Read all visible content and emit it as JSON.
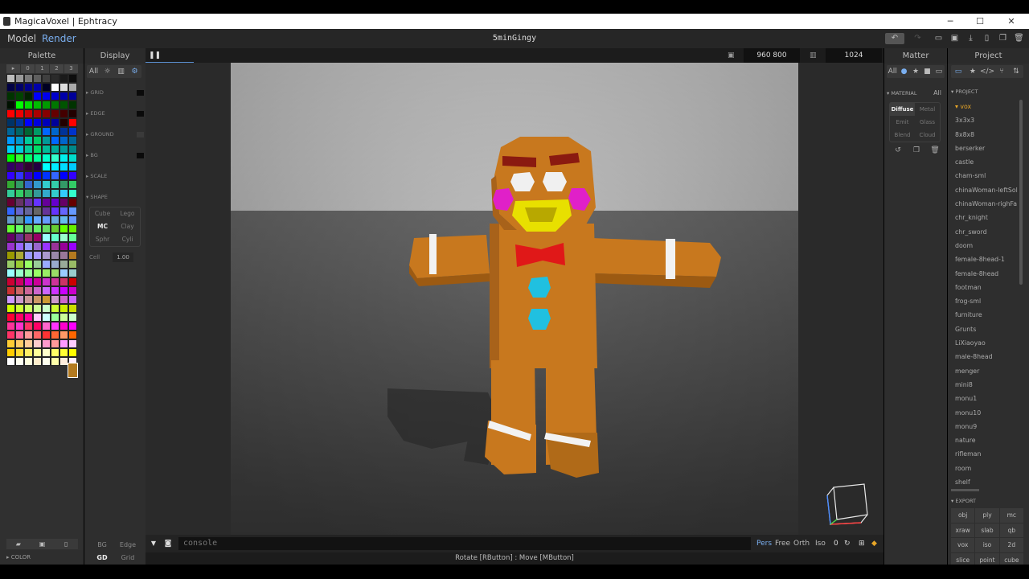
{
  "window": {
    "title": "MagicaVoxel | Ephtracy",
    "controls": [
      "─",
      "☐",
      "✕"
    ]
  },
  "menu": {
    "model": "Model",
    "render": "Render",
    "project_name": "5minGingy"
  },
  "toolbar_icons": [
    "undo-icon",
    "redo-icon",
    "open-icon",
    "save-icon",
    "export-icon",
    "new-icon",
    "copy-icon",
    "delete-icon"
  ],
  "palette": {
    "title": "Palette",
    "tabs": [
      "▸",
      "0",
      "1",
      "2",
      "3"
    ],
    "colors": [
      "#bdbdbd",
      "#9a9a9a",
      "#7a7a7a",
      "#5e5e5e",
      "#3f3f3f",
      "#2a2a2a",
      "#1a1a1a",
      "#0d0d0d",
      "#000044",
      "#000066",
      "#000088",
      "#0000aa",
      "#000022",
      "#ffffff",
      "#dddddd",
      "#aaaaaa",
      "#003300",
      "#004400",
      "#002200",
      "#0000ff",
      "#0000ee",
      "#0000cc",
      "#0000aa",
      "#000099",
      "#001100",
      "#00ff00",
      "#00dd00",
      "#00bb00",
      "#009900",
      "#007700",
      "#005500",
      "#003300",
      "#ff0000",
      "#ee0000",
      "#cc0000",
      "#aa0000",
      "#880000",
      "#660000",
      "#440000",
      "#220000",
      "#003366",
      "#003399",
      "#0000ff",
      "#0000dd",
      "#0000bb",
      "#000099",
      "#220000",
      "#ff0000",
      "#006699",
      "#006666",
      "#006633",
      "#009966",
      "#0066ff",
      "#0066cc",
      "#003399",
      "#0033cc",
      "#0099ff",
      "#0099cc",
      "#00cc99",
      "#00cc66",
      "#009999",
      "#0066ff",
      "#0066cc",
      "#006699",
      "#00ccff",
      "#00ccdd",
      "#00cc99",
      "#00dd66",
      "#00bb99",
      "#00aa99",
      "#009999",
      "#008888",
      "#00ff00",
      "#33ff33",
      "#00ff66",
      "#00ff99",
      "#00ffcc",
      "#33ffcc",
      "#00eeee",
      "#00ddcc",
      "#330066",
      "#440066",
      "#330033",
      "#220044",
      "#00ffff",
      "#00eeff",
      "#00ddff",
      "#00ccff",
      "#3300ff",
      "#3333ff",
      "#3300cc",
      "#0000ff",
      "#0033ff",
      "#3366ff",
      "#0000ff",
      "#3300ff",
      "#33aa33",
      "#339966",
      "#3366cc",
      "#3399cc",
      "#33cccc",
      "#33ccaa",
      "#339966",
      "#33cc66",
      "#33cc99",
      "#33cc66",
      "#33aa66",
      "#339999",
      "#33aacc",
      "#33cccc",
      "#33ccff",
      "#33ffcc",
      "#660033",
      "#663366",
      "#6633aa",
      "#6633ff",
      "#660099",
      "#6600cc",
      "#660066",
      "#660000",
      "#3366ff",
      "#6666cc",
      "#666699",
      "#666666",
      "#663399",
      "#6633ff",
      "#6666ff",
      "#6699ff",
      "#6699cc",
      "#669999",
      "#3399ff",
      "#66aaff",
      "#6699ff",
      "#66aadd",
      "#66bbee",
      "#6699ff",
      "#66ff33",
      "#66ff66",
      "#66cc66",
      "#66ee66",
      "#66dd66",
      "#66cc33",
      "#66ff00",
      "#66ee00",
      "#660066",
      "#663399",
      "#993366",
      "#990066",
      "#99ffff",
      "#66ffcc",
      "#99ffcc",
      "#66ff99",
      "#9933cc",
      "#9966ff",
      "#9999ff",
      "#9966cc",
      "#9933ff",
      "#993399",
      "#990099",
      "#9900ff",
      "#999900",
      "#aaaa33",
      "#9999ff",
      "#aa99ff",
      "#aa99cc",
      "#9988aa",
      "#997799",
      "#b37a20",
      "#99cc66",
      "#99cc33",
      "#99ff66",
      "#99cc99",
      "#99aaff",
      "#99aacc",
      "#99aa99",
      "#99bb66",
      "#99ffff",
      "#99ffcc",
      "#99ff99",
      "#99ff66",
      "#99ee66",
      "#99dd66",
      "#99ccff",
      "#99cccc",
      "#cc0033",
      "#cc0066",
      "#cc00cc",
      "#cc0099",
      "#cc33cc",
      "#cc3399",
      "#cc3366",
      "#cc0000",
      "#cc3333",
      "#cc6666",
      "#cc6699",
      "#cc66cc",
      "#cc66ff",
      "#cc33ff",
      "#cc00ff",
      "#cc00cc",
      "#cc99ff",
      "#cc99cc",
      "#cc9999",
      "#cc9966",
      "#cc9933",
      "#cc99cc",
      "#cc66cc",
      "#cc66ff",
      "#ccff00",
      "#ccff33",
      "#ccff66",
      "#ccff99",
      "#ccffcc",
      "#ccff33",
      "#ccee00",
      "#ccdd00",
      "#ff0033",
      "#ff0066",
      "#ff0099",
      "#ffccff",
      "#ccffff",
      "#99ff99",
      "#ccff99",
      "#ccffcc",
      "#ff3399",
      "#ff33cc",
      "#ff3366",
      "#ff0066",
      "#ff66cc",
      "#ff33ff",
      "#ff00cc",
      "#ff00ff",
      "#ff3366",
      "#ff6699",
      "#ff9999",
      "#ff6666",
      "#ff3333",
      "#ff6633",
      "#ff9966",
      "#ff6600",
      "#ffcc33",
      "#ffcc66",
      "#ffcc99",
      "#ffcccc",
      "#ff99cc",
      "#ff9999",
      "#ff99ff",
      "#ffccff",
      "#ffcc00",
      "#ffdd33",
      "#ffee66",
      "#ffff99",
      "#ffffcc",
      "#ffff66",
      "#ffff33",
      "#ffff00",
      "#ffffff",
      "#fffff0",
      "#ffffdd",
      "#ffeecc",
      "#ffffee",
      "#ffffaa",
      "#ffeedd",
      "#ffeeff"
    ],
    "bottom_icons": [
      "folder-icon",
      "save-icon",
      "file-icon"
    ],
    "color_label": "COLOR"
  },
  "display": {
    "title": "Display",
    "tabs": [
      "All",
      "☼",
      "▥",
      "⚙"
    ],
    "sections": [
      "GRID",
      "EDGE",
      "GROUND",
      "BG",
      "SCALE",
      "SHAPE"
    ],
    "shapes": [
      "Cube",
      "Lego",
      "MC",
      "Clay",
      "Sphr",
      "Cyli"
    ],
    "cell_label": "Cell",
    "cell_value": "1.00",
    "bottom": [
      "BG",
      "Edge",
      "GD",
      "Grid"
    ]
  },
  "render": {
    "resolution": "960  800",
    "samples": "1024",
    "console_placeholder": "console",
    "projections": [
      "Pers",
      "Free",
      "Orth",
      "Iso"
    ],
    "iso_value": "0",
    "status": "Rotate [RButton] : Move [MButton]"
  },
  "matter": {
    "title": "Matter",
    "tabs": [
      "All",
      "●",
      "★",
      "■",
      "▭"
    ],
    "material_label": "MATERIAL",
    "material_all": "All",
    "materials": [
      "Diffuse",
      "Metal",
      "Emit",
      "Glass",
      "Blend",
      "Cloud"
    ]
  },
  "project": {
    "title": "Project",
    "section": "PROJECT",
    "items": [
      "▾ vox",
      "3x3x3",
      "8x8x8",
      "berserker",
      "castle",
      "cham-sml",
      "chinaWoman-leftSol",
      "chinaWoman-righFa",
      "chr_knight",
      "chr_sword",
      "doom",
      "female-8head-1",
      "female-8head",
      "footman",
      "frog-sml",
      "furniture",
      "Grunts",
      "LiXiaoyao",
      "male-8head",
      "menger",
      "mini8",
      "monu1",
      "monu10",
      "monu9",
      "nature",
      "rifleman",
      "room",
      "shelf"
    ],
    "export_label": "EXPORT",
    "export_formats": [
      "obj",
      "ply",
      "mc",
      "xraw",
      "slab",
      "qb",
      "vox",
      "iso",
      "2d",
      "slice",
      "point",
      "cube"
    ]
  },
  "colors": {
    "accent": "#7aaff0",
    "active_file": "#e8a628",
    "gingerbread": "#c8781e"
  }
}
